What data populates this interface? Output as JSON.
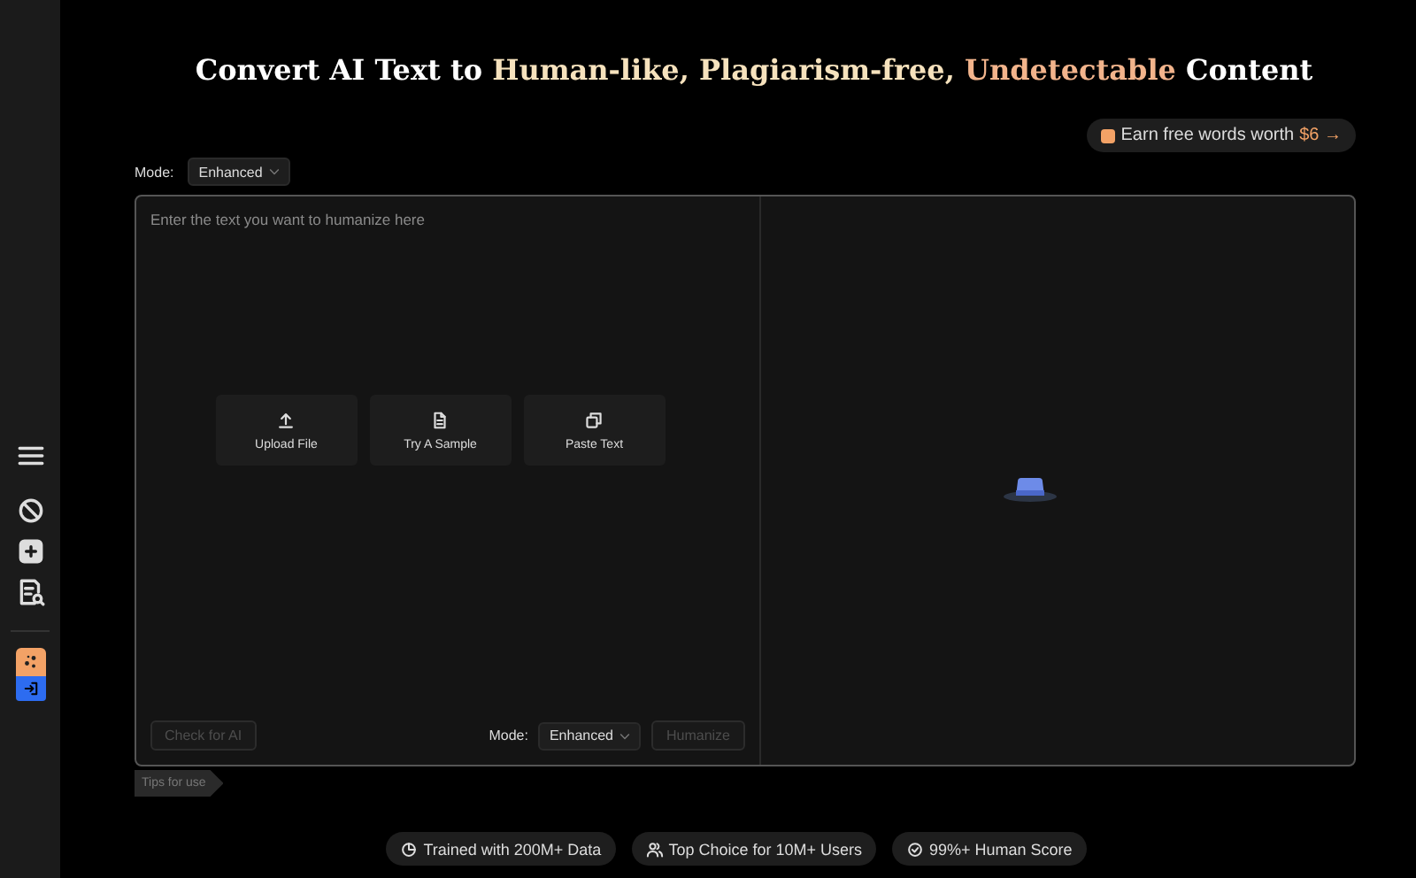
{
  "sidebar": {
    "items": [
      {
        "kind": "menu"
      },
      {
        "kind": "history"
      },
      {
        "kind": "add"
      },
      {
        "kind": "doc-search"
      },
      {
        "kind": "divider"
      },
      {
        "kind": "ai"
      },
      {
        "kind": "login"
      }
    ]
  },
  "title": [
    {
      "text": "Convert AI Text to ",
      "color": "#ffffff"
    },
    {
      "text": "Human-like, Plagiarism-free, ",
      "color": "#f6e2bd"
    },
    {
      "text": "Undetectable",
      "color": "#f2b48c"
    },
    {
      "text": " Content",
      "color": "#ffffff"
    }
  ],
  "promo": {
    "text": "Earn free words worth",
    "amount": "$6",
    "arrow": "→"
  },
  "mode_top": {
    "label": "Mode:",
    "value": "Enhanced"
  },
  "editor": {
    "placeholder": "Enter the text you want to humanize here",
    "actions": [
      {
        "kind": "upload",
        "label": "Upload File"
      },
      {
        "kind": "sample",
        "label": "Try A Sample"
      },
      {
        "kind": "paste",
        "label": "Paste Text"
      }
    ],
    "check_button": {
      "label": "Check for AI",
      "disabled": true
    },
    "mode_bottom": {
      "label": "Mode:",
      "value": "Enhanced"
    },
    "humanize_button": {
      "label": "Humanize",
      "disabled": true
    }
  },
  "tips": "Tips for use",
  "badges": [
    {
      "kind": "chart",
      "text": "Trained with 200M+ Data"
    },
    {
      "kind": "users",
      "text": "Top Choice for 10M+ Users"
    },
    {
      "kind": "check",
      "text": "99%+ Human Score"
    }
  ]
}
